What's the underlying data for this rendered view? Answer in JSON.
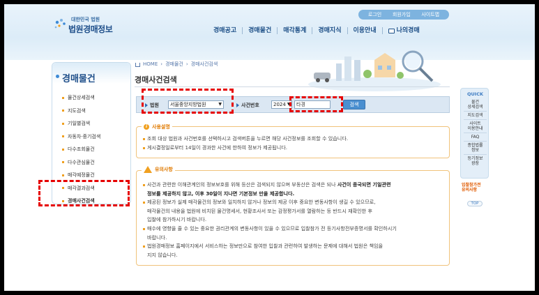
{
  "header": {
    "logo_small": "대한민국 법원",
    "logo_big": "법원경매정보",
    "util_links": [
      "로그인",
      "회원가입",
      "사이트맵"
    ],
    "gnb": [
      "경매공고",
      "경매물건",
      "매각통계",
      "경매지식",
      "이용안내"
    ],
    "gnb_my": "나의경매"
  },
  "sidebar": {
    "title": "경매물건",
    "items": [
      {
        "label": "물건상세검색"
      },
      {
        "label": "지도검색"
      },
      {
        "label": "기일별검색"
      },
      {
        "label": "자동차·중기검색"
      },
      {
        "label": "다수조회물건"
      },
      {
        "label": "다수관심물건"
      },
      {
        "label": "매각예정물건"
      },
      {
        "label": "매각결과검색"
      },
      {
        "label": "경매사건검색"
      }
    ]
  },
  "breadcrumb": [
    "HOME",
    "경매물건",
    "경매사건검색"
  ],
  "page_title": "경매사건검색",
  "search": {
    "court_label": "법원",
    "court_value": "서울중앙지방법원",
    "case_label": "사건번호",
    "year_value": "2024",
    "type_value": "타경",
    "button_label": "검색"
  },
  "usage": {
    "title": "사용설명",
    "lines": [
      "조회 대상 법원과 사건번호를 선택하시고 검색버튼을 누르면 해당 사건정보를 조회할 수 있습니다.",
      "게시결정일로부터 14일이 경과한 사건에 한하여 정보가 제공됩니다."
    ]
  },
  "caution": {
    "title": "유의사항",
    "line1_a": "사건과 관련한 이해관계인의 정보보호를 위해 등산은 검색되지 않으며 부동산은 검색은 되나 ",
    "line1_b": "사건이 종국되면 기일관련",
    "line2": "정보를 제공하지 않고, 이후 30일이 지나면 기본정보 만을 제공합니다.",
    "line3": "제공된 정보가 실제 매각물건의 정보와 일치하지 않거나 정보의 제공 이후 중요한 변동사항이 생길 수 있으므로,",
    "line4": "매각물건의 내용을 법원에 비치된 물건명세서, 현황조사서 또는 감정평가서를 열람하는 등 반드시 재확인한 후",
    "line5": "입찰에 참가하시기 바랍니다.",
    "line6": "매수에 영향을 줄 수 있는 중요한 권리관계의 변동사항이 있을 수 있으므로 입찰참가 전 등기사항전부증명서를 확인하시기",
    "line7": "바랍니다.",
    "line8": "법원경매정보 홈페이지에서 서비스하는 정보만으로 참여한 입찰과 관련하여 발생하는 문제에 대해서 법원은 책임을",
    "line9": "지지 않습니다."
  },
  "quick": {
    "title": "QUICK",
    "items": [
      [
        "물건",
        "상세검색"
      ],
      [
        "지도검색"
      ],
      [
        "사이트",
        "이용안내"
      ],
      [
        "FAQ"
      ],
      [
        "종합법률",
        "정보"
      ],
      [
        "등기정보",
        "광장"
      ]
    ],
    "notice_a": "입찰참가전",
    "notice_b": "유의사항",
    "top": "TOP"
  }
}
